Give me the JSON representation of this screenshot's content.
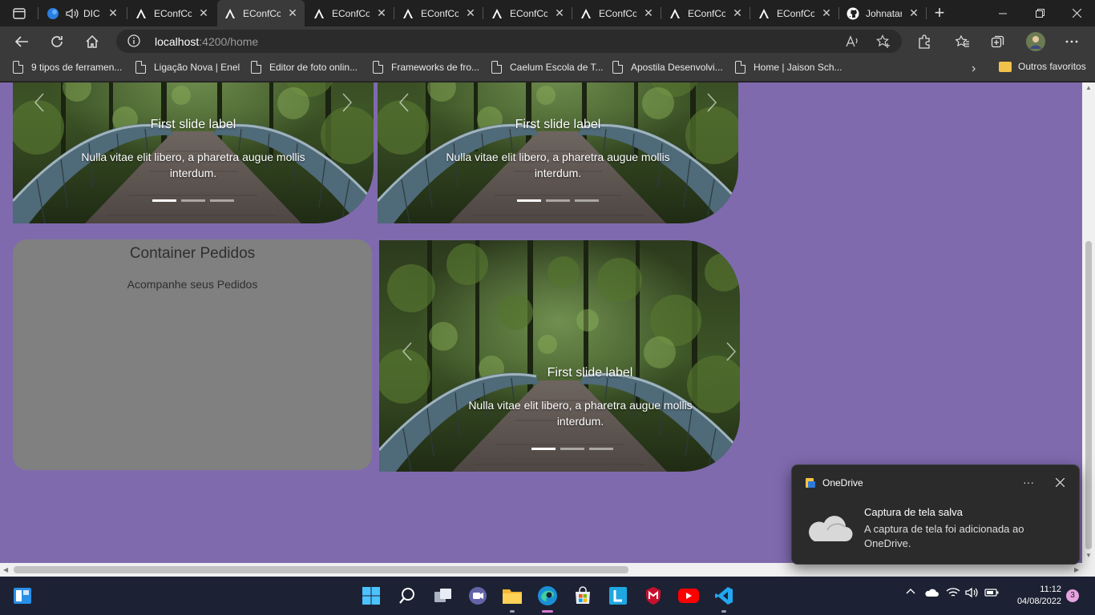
{
  "browser": {
    "tabs": [
      {
        "title": "DIC",
        "icon": "edge-drop-icon",
        "active": false
      },
      {
        "title": "EConfCompras",
        "icon": "angular-icon",
        "active": false
      },
      {
        "title": "EConfCompras",
        "icon": "angular-icon",
        "active": true
      },
      {
        "title": "EConfCompras",
        "icon": "angular-icon",
        "active": false
      },
      {
        "title": "EConfCompras",
        "icon": "angular-icon",
        "active": false
      },
      {
        "title": "EConfCompras",
        "icon": "angular-icon",
        "active": false
      },
      {
        "title": "EConfCompras",
        "icon": "angular-icon",
        "active": false
      },
      {
        "title": "EConfCompras",
        "icon": "angular-icon",
        "active": false
      },
      {
        "title": "EConfCompras",
        "icon": "angular-icon",
        "active": false
      },
      {
        "title": "Johnatan",
        "icon": "github-icon",
        "active": false
      }
    ],
    "address": {
      "host": "localhost",
      "path": ":4200/home"
    },
    "bookmarks": [
      "9 tipos de ferramen...",
      "Ligação Nova | Enel",
      "Editor de foto onlin...",
      "Frameworks de fro...",
      "Caelum Escola de T...",
      "Apostila Desenvolvi...",
      "Home | Jaison Sch..."
    ],
    "other_favorites": "Outros favoritos",
    "colors": {
      "page_bg": "#7f6aae",
      "card_bg": "#808080"
    }
  },
  "page": {
    "carousels": [
      {
        "title": "First slide label",
        "text": "Nulla vitae elit libero, a pharetra augue mollis interdum.",
        "active_index": 0,
        "slide_count": 3
      },
      {
        "title": "First slide label",
        "text": "Nulla vitae elit libero, a pharetra augue mollis interdum.",
        "active_index": 0,
        "slide_count": 3
      },
      {
        "title": "First slide label",
        "text": "Nulla vitae elit libero, a pharetra augue mollis interdum.",
        "active_index": 0,
        "slide_count": 3
      }
    ],
    "orders": {
      "title": "Container Pedidos",
      "subtitle": "Acompanhe seus Pedidos"
    }
  },
  "toast": {
    "app": "OneDrive",
    "title": "Captura de tela salva",
    "body": "A captura de tela foi adicionada ao OneDrive."
  },
  "taskbar": {
    "time": "11:12",
    "date": "04/08/2022",
    "notifications": "3"
  }
}
